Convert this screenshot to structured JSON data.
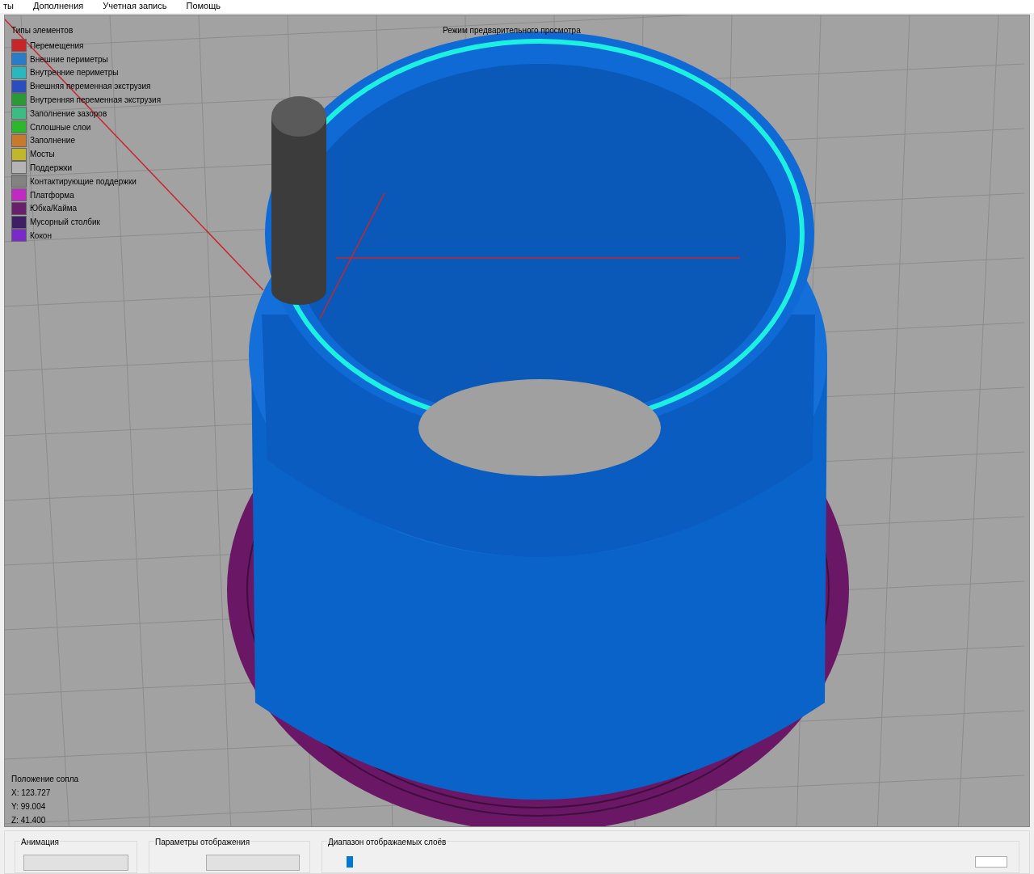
{
  "menu": [
    "ты",
    "Дополнения",
    "Учетная запись",
    "Помощь"
  ],
  "viewport": {
    "title": "Режим предварительного просмотра",
    "legend": {
      "title": "Типы элементов",
      "items": [
        {
          "label": "Перемещения",
          "color": "#c8262a"
        },
        {
          "label": "Внешние периметры",
          "color": "#2a7cc8"
        },
        {
          "label": "Внутренние периметры",
          "color": "#2ab8c0"
        },
        {
          "label": "Внешняя переменная экструзия",
          "color": "#2a4ec0"
        },
        {
          "label": "Внутренняя переменная экструзия",
          "color": "#2a9a36"
        },
        {
          "label": "Заполнение зазоров",
          "color": "#3cbc82"
        },
        {
          "label": "Сплошные слои",
          "color": "#2cb82c"
        },
        {
          "label": "Заполнение",
          "color": "#c87a2a"
        },
        {
          "label": "Мосты",
          "color": "#c0b82a"
        },
        {
          "label": "Поддержки",
          "color": "#b4b4b4"
        },
        {
          "label": "Контактирующие поддержки",
          "color": "#828282"
        },
        {
          "label": "Платформа",
          "color": "#c02ac0"
        },
        {
          "label": "Юбка/Кайма",
          "color": "#6a1e6e"
        },
        {
          "label": "Мусорный столбик",
          "color": "#3e1e64"
        },
        {
          "label": "Кокон",
          "color": "#7a2ac8"
        }
      ]
    },
    "nozzle": {
      "title": "Положение сопла",
      "lines": [
        "X: 123.727",
        "Y: 99.004",
        "Z: 41.400"
      ]
    }
  },
  "panels": [
    {
      "kind": "animation",
      "title": "Анимация"
    },
    {
      "kind": "display",
      "title": "Параметры отображения"
    },
    {
      "kind": "layers",
      "title": "Диапазон отображаемых слоёв"
    }
  ]
}
